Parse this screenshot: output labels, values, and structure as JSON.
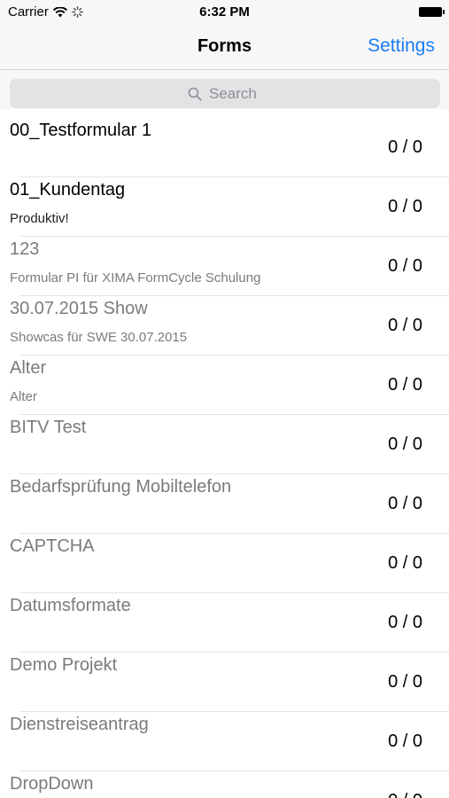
{
  "status_bar": {
    "carrier": "Carrier",
    "time": "6:32 PM"
  },
  "nav": {
    "title": "Forms",
    "settings_label": "Settings"
  },
  "search": {
    "placeholder": "Search"
  },
  "colors": {
    "accent": "#1a7cf5",
    "active_text": "#000000",
    "inactive_text": "#7b7b7b"
  },
  "forms": [
    {
      "title": "00_Testformular 1",
      "subtitle": "",
      "count": "0 / 0",
      "active": true
    },
    {
      "title": "01_Kundentag",
      "subtitle": "Produktiv!",
      "count": "0 / 0",
      "active": true
    },
    {
      "title": "123",
      "subtitle": "Formular PI für XIMA FormCycle Schulung",
      "count": "0 / 0",
      "active": false
    },
    {
      "title": "30.07.2015 Show",
      "subtitle": "Showcas für SWE 30.07.2015",
      "count": "0 / 0",
      "active": false
    },
    {
      "title": "Alter",
      "subtitle": "Alter",
      "count": "0 / 0",
      "active": false
    },
    {
      "title": "BITV Test",
      "subtitle": "",
      "count": "0 / 0",
      "active": false
    },
    {
      "title": "Bedarfsprüfung Mobiltelefon",
      "subtitle": "",
      "count": "0 / 0",
      "active": false
    },
    {
      "title": "CAPTCHA",
      "subtitle": "",
      "count": "0 / 0",
      "active": false
    },
    {
      "title": "Datumsformate",
      "subtitle": "",
      "count": "0 / 0",
      "active": false
    },
    {
      "title": "Demo Projekt",
      "subtitle": "",
      "count": "0 / 0",
      "active": false
    },
    {
      "title": "Dienstreiseantrag",
      "subtitle": "",
      "count": "0 / 0",
      "active": false
    },
    {
      "title": "DropDown",
      "subtitle": "",
      "count": "0 / 0",
      "active": false
    }
  ]
}
